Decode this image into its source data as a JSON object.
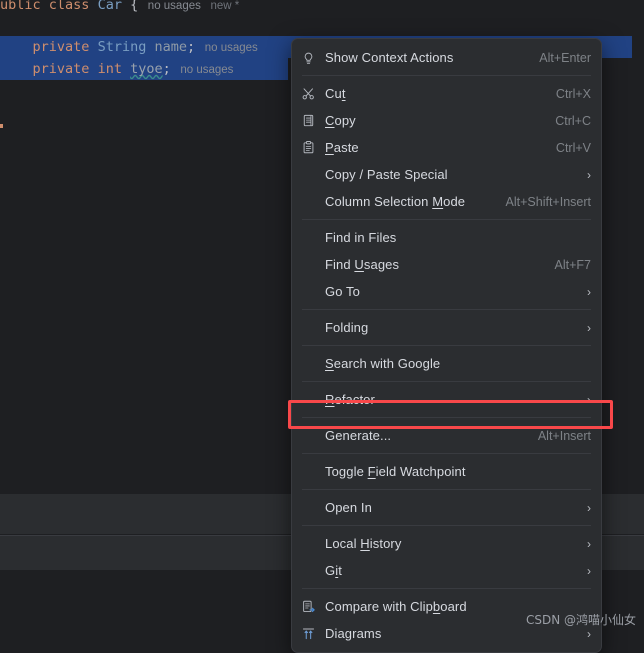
{
  "editor": {
    "lines": [
      {
        "id": "class-line",
        "segments": [
          {
            "text": "ublic",
            "cls": "kw"
          },
          {
            "text": " ",
            "cls": "pun"
          },
          {
            "text": "class",
            "cls": "kw"
          },
          {
            "text": " ",
            "cls": "pun"
          },
          {
            "text": "Car",
            "cls": "typ"
          },
          {
            "text": " {",
            "cls": "pun"
          }
        ],
        "hints": [
          "no usages",
          "new *"
        ]
      },
      {
        "id": "name-line",
        "segments": [
          {
            "text": "    ",
            "cls": "indent"
          },
          {
            "text": "private",
            "cls": "kw"
          },
          {
            "text": " ",
            "cls": "pun"
          },
          {
            "text": "String",
            "cls": "typ"
          },
          {
            "text": " ",
            "cls": "pun"
          },
          {
            "text": "name",
            "cls": "fld"
          },
          {
            "text": ";",
            "cls": "pun"
          }
        ],
        "hints": [
          "no usages"
        ]
      },
      {
        "id": "type-line",
        "segments": [
          {
            "text": "    ",
            "cls": "indent"
          },
          {
            "text": "private",
            "cls": "kw"
          },
          {
            "text": " ",
            "cls": "pun"
          },
          {
            "text": "int",
            "cls": "kw"
          },
          {
            "text": " ",
            "cls": "pun"
          },
          {
            "text": "tyoe",
            "cls": "err"
          },
          {
            "text": ";",
            "cls": "pun"
          }
        ],
        "hints": [
          "no usages"
        ]
      }
    ]
  },
  "context_menu": {
    "items": [
      {
        "label": "Show Context Actions",
        "label_pre": "",
        "mnemonic": "",
        "label_post": "Show Context Actions",
        "shortcut": "Alt+Enter",
        "icon": "lightbulb-icon",
        "submenu": false
      },
      {
        "sep": true
      },
      {
        "label": "Cut",
        "label_pre": "Cu",
        "mnemonic": "t",
        "label_post": "",
        "shortcut": "Ctrl+X",
        "icon": "scissors-icon",
        "submenu": false
      },
      {
        "label": "Copy",
        "label_pre": "",
        "mnemonic": "C",
        "label_post": "opy",
        "shortcut": "Ctrl+C",
        "icon": "copy-icon",
        "submenu": false
      },
      {
        "label": "Paste",
        "label_pre": "",
        "mnemonic": "P",
        "label_post": "aste",
        "shortcut": "Ctrl+V",
        "icon": "paste-icon",
        "submenu": false
      },
      {
        "label": "Copy / Paste Special",
        "label_pre": "Copy / Paste Special",
        "mnemonic": "",
        "label_post": "",
        "shortcut": "",
        "icon": "",
        "submenu": true
      },
      {
        "label": "Column Selection Mode",
        "label_pre": "Column Selection ",
        "mnemonic": "M",
        "label_post": "ode",
        "shortcut": "Alt+Shift+Insert",
        "icon": "",
        "submenu": false
      },
      {
        "sep": true
      },
      {
        "label": "Find in Files",
        "label_pre": "Find in Files",
        "mnemonic": "",
        "label_post": "",
        "shortcut": "",
        "icon": "",
        "submenu": false
      },
      {
        "label": "Find Usages",
        "label_pre": "Find ",
        "mnemonic": "U",
        "label_post": "sages",
        "shortcut": "Alt+F7",
        "icon": "",
        "submenu": false
      },
      {
        "label": "Go To",
        "label_pre": "Go To",
        "mnemonic": "",
        "label_post": "",
        "shortcut": "",
        "icon": "",
        "submenu": true
      },
      {
        "sep": true
      },
      {
        "label": "Folding",
        "label_pre": "Folding",
        "mnemonic": "",
        "label_post": "",
        "shortcut": "",
        "icon": "",
        "submenu": true
      },
      {
        "sep": true
      },
      {
        "label": "Search with Google",
        "label_pre": "",
        "mnemonic": "S",
        "label_post": "earch with Google",
        "shortcut": "",
        "icon": "",
        "submenu": false
      },
      {
        "sep": true
      },
      {
        "label": "Refactor",
        "label_pre": "",
        "mnemonic": "R",
        "label_post": "efactor",
        "shortcut": "",
        "icon": "",
        "submenu": true
      },
      {
        "sep": true
      },
      {
        "label": "Generate...",
        "label_pre": "Generate...",
        "mnemonic": "",
        "label_post": "",
        "shortcut": "Alt+Insert",
        "icon": "",
        "submenu": false,
        "highlighted": true
      },
      {
        "sep": true
      },
      {
        "label": "Toggle Field Watchpoint",
        "label_pre": "Toggle ",
        "mnemonic": "F",
        "label_post": "ield Watchpoint",
        "shortcut": "",
        "icon": "",
        "submenu": false
      },
      {
        "sep": true
      },
      {
        "label": "Open In",
        "label_pre": "Open In",
        "mnemonic": "",
        "label_post": "",
        "shortcut": "",
        "icon": "",
        "submenu": true
      },
      {
        "sep": true
      },
      {
        "label": "Local History",
        "label_pre": "Local ",
        "mnemonic": "H",
        "label_post": "istory",
        "shortcut": "",
        "icon": "",
        "submenu": true
      },
      {
        "label": "Git",
        "label_pre": "G",
        "mnemonic": "i",
        "label_post": "t",
        "shortcut": "",
        "icon": "",
        "submenu": true
      },
      {
        "sep": true
      },
      {
        "label": "Compare with Clipboard",
        "label_pre": "Compare with Clip",
        "mnemonic": "b",
        "label_post": "oard",
        "shortcut": "",
        "icon": "compare-clipboard-icon",
        "submenu": false
      },
      {
        "label": "Diagrams",
        "label_pre": "Diagrams",
        "mnemonic": "",
        "label_post": "",
        "shortcut": "",
        "icon": "diagrams-icon",
        "submenu": true
      }
    ],
    "submenu_arrow": "›"
  },
  "annotation": {
    "target": "Generate...",
    "color": "#f8484a"
  },
  "watermark": {
    "text": "CSDN @鸿喵小仙女"
  },
  "colors": {
    "menu_background": "#2b2d30",
    "menu_border": "#393b40",
    "editor_background": "#1e1f22",
    "selection": "#214283",
    "keyword": "#cf8e6d",
    "type": "#7a9ec2",
    "field": "#8f9aa6",
    "annotation_red": "#f8484a",
    "panel": "#2b2d30"
  }
}
